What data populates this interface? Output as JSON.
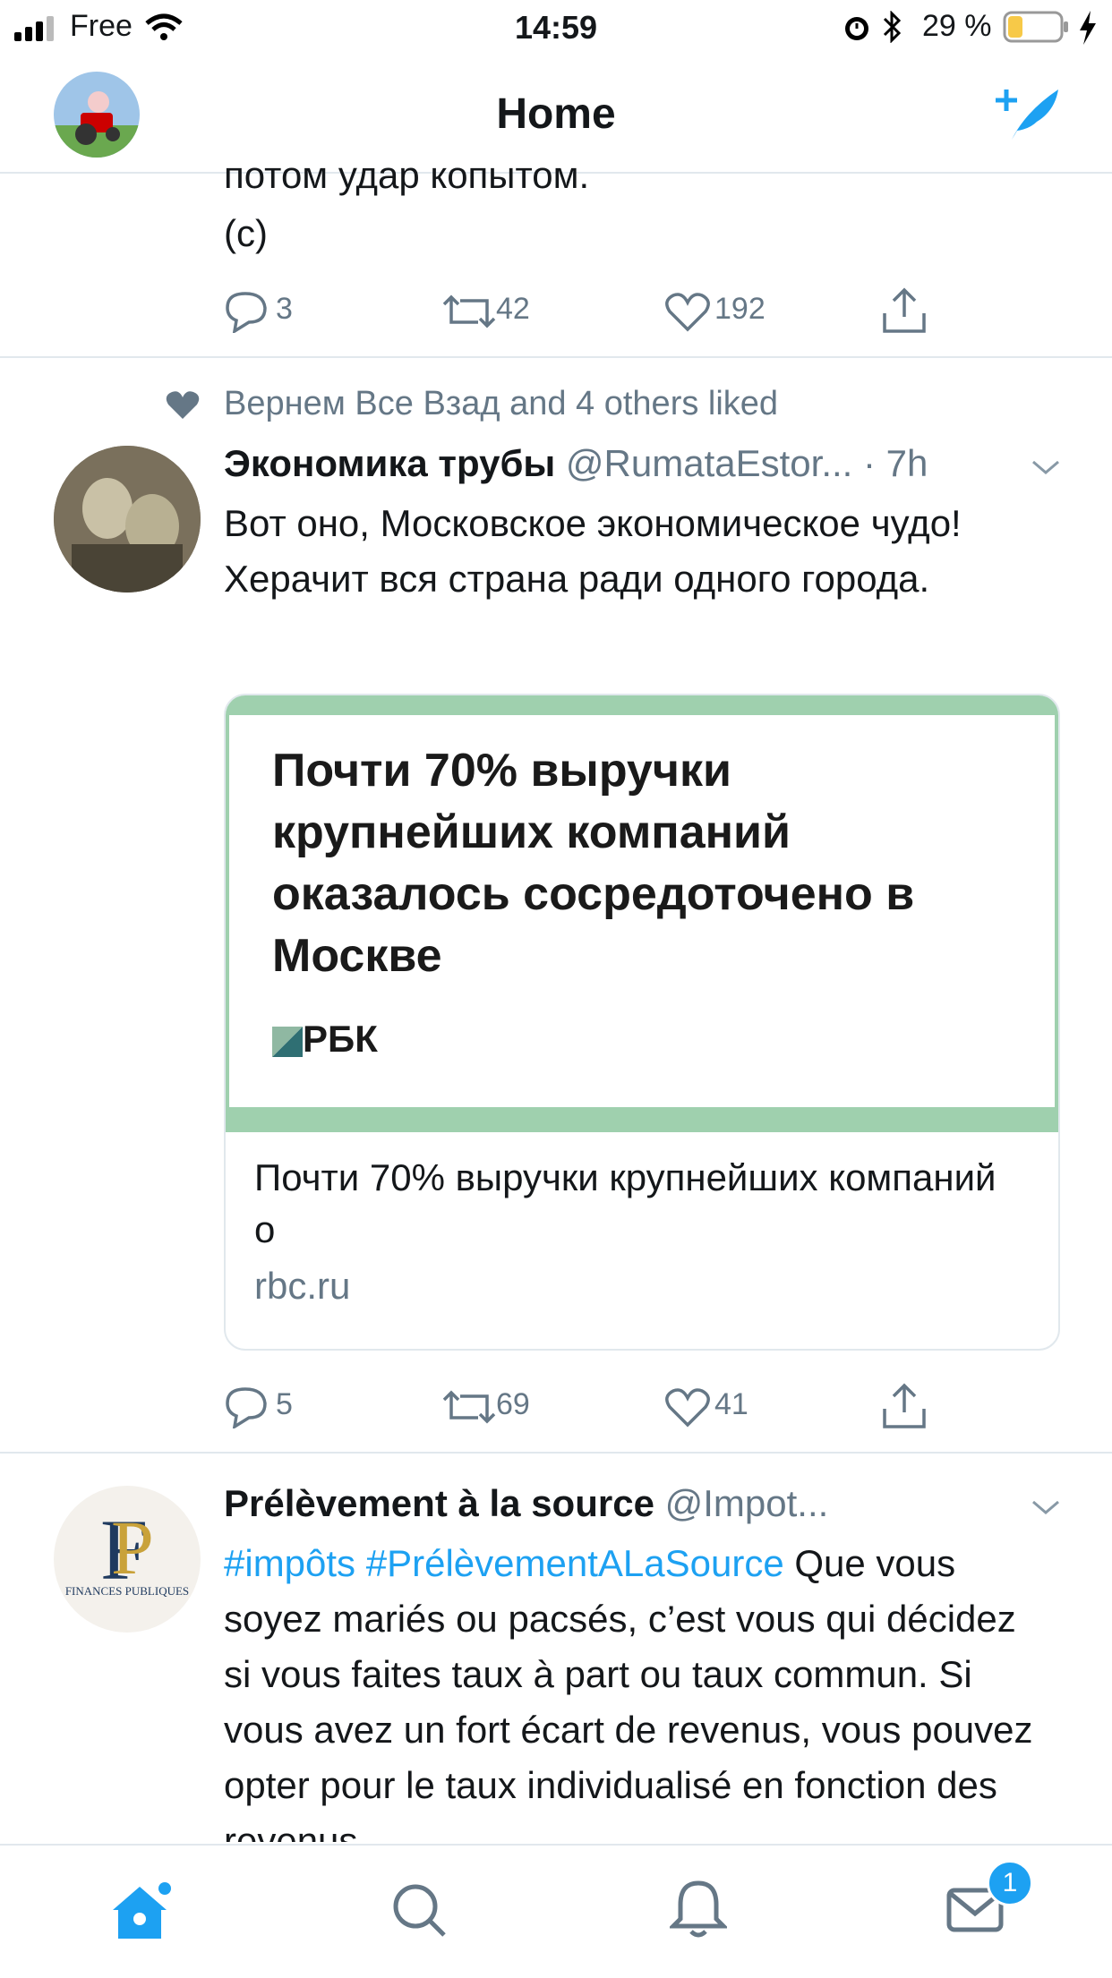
{
  "status_bar": {
    "carrier": "Free",
    "time": "14:59",
    "battery_percent": "29 %",
    "battery_level": 0.29,
    "icons": [
      "signal-icon",
      "wifi-icon",
      "alarm-icon",
      "bluetooth-icon",
      "battery-icon",
      "charging-icon"
    ]
  },
  "header": {
    "title": "Home",
    "compose_icon": "compose-tweet-icon"
  },
  "tweet0": {
    "text_line1": "потом удар копытом.",
    "text_line2": "(с)",
    "replies": "3",
    "retweets": "42",
    "likes": "192"
  },
  "tweet1": {
    "social_context": "Вернем Все Взад and 4 others liked",
    "display_name": "Экономика трубы",
    "handle": "@RumataEstor...",
    "time": "· 7h",
    "text": "Вот оно, Московское экономическое чудо! Херачит вся страна ради одного города.",
    "card": {
      "image_headline": "Почти 70% выручки крупнейших компаний оказалось сосредоточено в Москве",
      "image_source": "РБК",
      "description": "Почти 70% выручки крупнейших компаний о",
      "domain": "rbc.ru"
    },
    "replies": "5",
    "retweets": "69",
    "likes": "41"
  },
  "tweet2": {
    "display_name": "Prélèvement à la source",
    "handle": "@Impot...",
    "hashtag1": "#impôts",
    "hashtag2": "#PrélèvementALaSource",
    "text_after": " Que vous soyez mariés ou pacsés, c’est vous qui décidez si vous faites taux à part ou taux commun. Si vous avez un fort écart de revenus, vous pouvez opter pour le taux individualisé en fonction des revenus",
    "avatar_text": "FINANCES PUBLIQUES"
  },
  "tabbar": {
    "messages_badge": "1",
    "tabs": [
      "home-icon",
      "search-icon",
      "notifications-icon",
      "messages-icon"
    ]
  },
  "colors": {
    "accent": "#1da1f2",
    "gray": "#657786",
    "card_green": "#9fd0ae"
  }
}
